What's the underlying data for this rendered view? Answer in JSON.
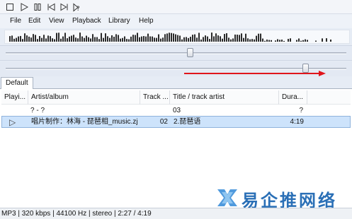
{
  "toolbar": {
    "buttons": [
      {
        "name": "stop-button",
        "icon": "stop-icon"
      },
      {
        "name": "play-button",
        "icon": "play-icon"
      },
      {
        "name": "pause-button",
        "icon": "pause-icon"
      },
      {
        "name": "previous-button",
        "icon": "previous-icon"
      },
      {
        "name": "next-button",
        "icon": "next-icon"
      },
      {
        "name": "random-button",
        "icon": "random-icon"
      }
    ]
  },
  "menu": {
    "file": "File",
    "edit": "Edit",
    "view": "View",
    "playback": "Playback",
    "library": "Library",
    "help": "Help"
  },
  "seek": {
    "position_fraction": 0.54
  },
  "volume": {
    "level_fraction": 0.88
  },
  "tabs": [
    "Default"
  ],
  "playlist": {
    "columns": {
      "playing": "Playi...",
      "artist_album": "Artist/album",
      "track_no": "Track ...",
      "title_artist": "Title / track artist",
      "duration": "Dura..."
    },
    "rows": [
      {
        "playing": "",
        "artist_album": "? - ?",
        "track_no": "",
        "title": "03",
        "duration": "?"
      },
      {
        "playing": "▷",
        "artist_album": "唱片制作：林海 - 琵琶相_music.zj...",
        "track_no": "02",
        "title": "2.琵琶语",
        "duration": "4:19"
      }
    ]
  },
  "watermark": {
    "text": "易企推网络"
  },
  "status": {
    "text": "MP3 | 320 kbps | 44100 Hz | stereo | 2:27 / 4:19"
  },
  "colors": {
    "arrow": "#e0151b",
    "selection": "#cde3fb",
    "watermark": "#2a6fb6"
  }
}
